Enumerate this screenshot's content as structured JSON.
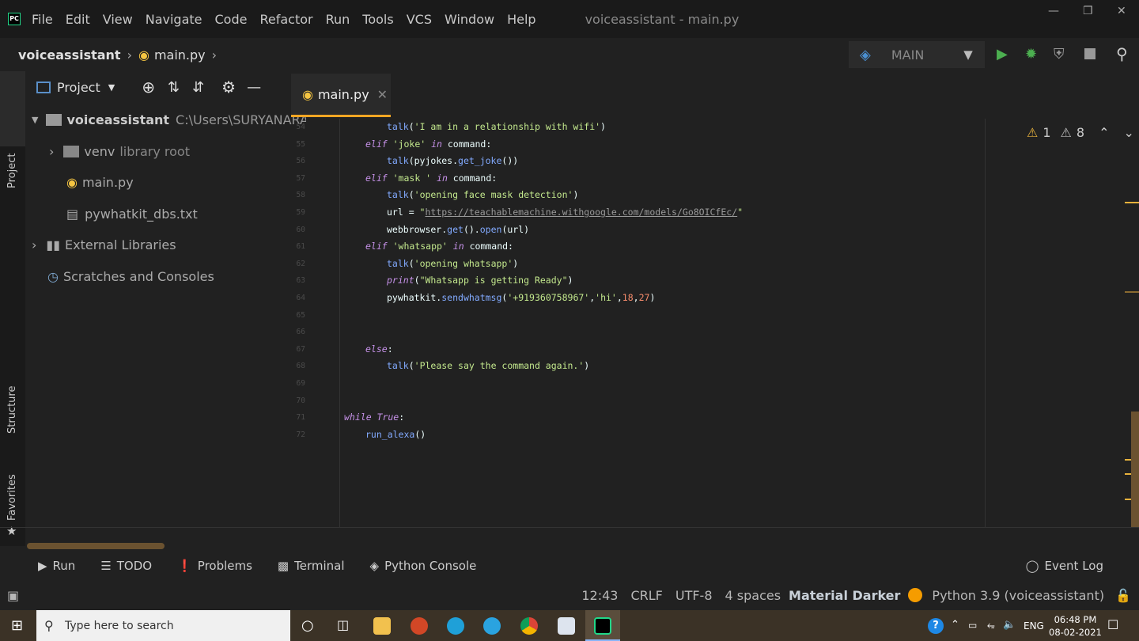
{
  "menu": {
    "items": [
      "File",
      "Edit",
      "View",
      "Navigate",
      "Code",
      "Refactor",
      "Run",
      "Tools",
      "VCS",
      "Window",
      "Help"
    ],
    "title": "voiceassistant - main.py"
  },
  "nav": {
    "project": "voiceassistant",
    "file": "main.py",
    "run_config": "MAIN"
  },
  "project": {
    "header": "Project",
    "root": "voiceassistant",
    "root_path": "C:\\Users\\SURYANARAY",
    "venv": "venv",
    "venv_note": "library root",
    "main": "main.py",
    "dbs": "pywhatkit_dbs.txt",
    "ext": "External Libraries",
    "scratch": "Scratches and Consoles"
  },
  "side": {
    "project": "Project",
    "structure": "Structure",
    "favorites": "Favorites"
  },
  "tab": {
    "label": "main.py"
  },
  "inspections": {
    "weak": "1",
    "warn": "8"
  },
  "code": [
    {
      "n": "54",
      "i": 2,
      "t": [
        [
          "f",
          "talk"
        ],
        [
          "",
          "("
        ],
        [
          "s",
          "'I am in a relationship with wifi'"
        ],
        [
          "",
          ")"
        ]
      ]
    },
    {
      "n": "55",
      "i": 1,
      "t": [
        [
          "k",
          "elif "
        ],
        [
          "s",
          "'joke'"
        ],
        [
          "k",
          " in "
        ],
        [
          "",
          "command:"
        ]
      ]
    },
    {
      "n": "56",
      "i": 2,
      "t": [
        [
          "f",
          "talk"
        ],
        [
          "",
          "(pyjokes."
        ],
        [
          "f",
          "get_joke"
        ],
        [
          "",
          "())"
        ]
      ]
    },
    {
      "n": "57",
      "i": 1,
      "t": [
        [
          "k",
          "elif "
        ],
        [
          "s",
          "'mask '"
        ],
        [
          "k",
          " in "
        ],
        [
          "",
          "command:"
        ]
      ]
    },
    {
      "n": "58",
      "i": 2,
      "t": [
        [
          "f",
          "talk"
        ],
        [
          "",
          "("
        ],
        [
          "s",
          "'opening face mask detection'"
        ],
        [
          "",
          ")"
        ]
      ]
    },
    {
      "n": "59",
      "i": 2,
      "t": [
        [
          "",
          "url = "
        ],
        [
          "s",
          "\""
        ],
        [
          "u",
          "https://teachablemachine.withgoogle.com/models/Go8OICfEc/"
        ],
        [
          "s",
          "\""
        ]
      ]
    },
    {
      "n": "60",
      "i": 2,
      "t": [
        [
          "",
          "webbrowser."
        ],
        [
          "f",
          "get"
        ],
        [
          "",
          "()."
        ],
        [
          "f",
          "open"
        ],
        [
          "",
          "(url)"
        ]
      ]
    },
    {
      "n": "61",
      "i": 1,
      "t": [
        [
          "k",
          "elif "
        ],
        [
          "s",
          "'whatsapp'"
        ],
        [
          "k",
          " in "
        ],
        [
          "",
          "command:"
        ]
      ]
    },
    {
      "n": "62",
      "i": 2,
      "t": [
        [
          "f",
          "talk"
        ],
        [
          "",
          "("
        ],
        [
          "s",
          "'opening whatsapp'"
        ],
        [
          "",
          ")"
        ]
      ]
    },
    {
      "n": "63",
      "i": 2,
      "t": [
        [
          "k",
          "print"
        ],
        [
          "",
          "("
        ],
        [
          "s",
          "\"Whatsapp is getting Ready\""
        ],
        [
          "",
          ")"
        ]
      ]
    },
    {
      "n": "64",
      "i": 2,
      "t": [
        [
          "",
          "pywhatkit."
        ],
        [
          "f",
          "sendwhatmsg"
        ],
        [
          "",
          "("
        ],
        [
          "s",
          "'+919360758967'"
        ],
        [
          "",
          ","
        ],
        [
          "s",
          "'hi'"
        ],
        [
          "",
          ","
        ],
        [
          "n",
          "18"
        ],
        [
          "",
          ","
        ],
        [
          "n",
          "27"
        ],
        [
          "",
          ")"
        ]
      ]
    },
    {
      "n": "65",
      "i": 0,
      "t": []
    },
    {
      "n": "66",
      "i": 0,
      "t": []
    },
    {
      "n": "67",
      "i": 1,
      "t": [
        [
          "k",
          "else"
        ],
        [
          "",
          ":"
        ]
      ]
    },
    {
      "n": "68",
      "i": 2,
      "t": [
        [
          "f",
          "talk"
        ],
        [
          "",
          "("
        ],
        [
          "s",
          "'Please say the command again.'"
        ],
        [
          "",
          ")"
        ]
      ]
    },
    {
      "n": "69",
      "i": 0,
      "t": []
    },
    {
      "n": "70",
      "i": 0,
      "t": []
    },
    {
      "n": "71",
      "i": 0,
      "t": [
        [
          "k",
          "while True"
        ],
        [
          "",
          ":"
        ]
      ]
    },
    {
      "n": "72",
      "i": 1,
      "t": [
        [
          "f",
          "run_alexa"
        ],
        [
          "",
          "()"
        ]
      ]
    }
  ],
  "bottom": {
    "run": "Run",
    "todo": "TODO",
    "problems": "Problems",
    "terminal": "Terminal",
    "console": "Python Console",
    "event": "Event Log"
  },
  "status": {
    "pos": "12:43",
    "eol": "CRLF",
    "enc": "UTF-8",
    "indent": "4 spaces",
    "theme": "Material Darker",
    "interp": "Python 3.9 (voiceassistant)"
  },
  "taskbar": {
    "search": "Type here to search",
    "lang": "ENG",
    "time": "06:48 PM",
    "date": "08-02-2021"
  },
  "colors": {
    "accent": "#f5a623",
    "taskbar": "#3b3226"
  }
}
